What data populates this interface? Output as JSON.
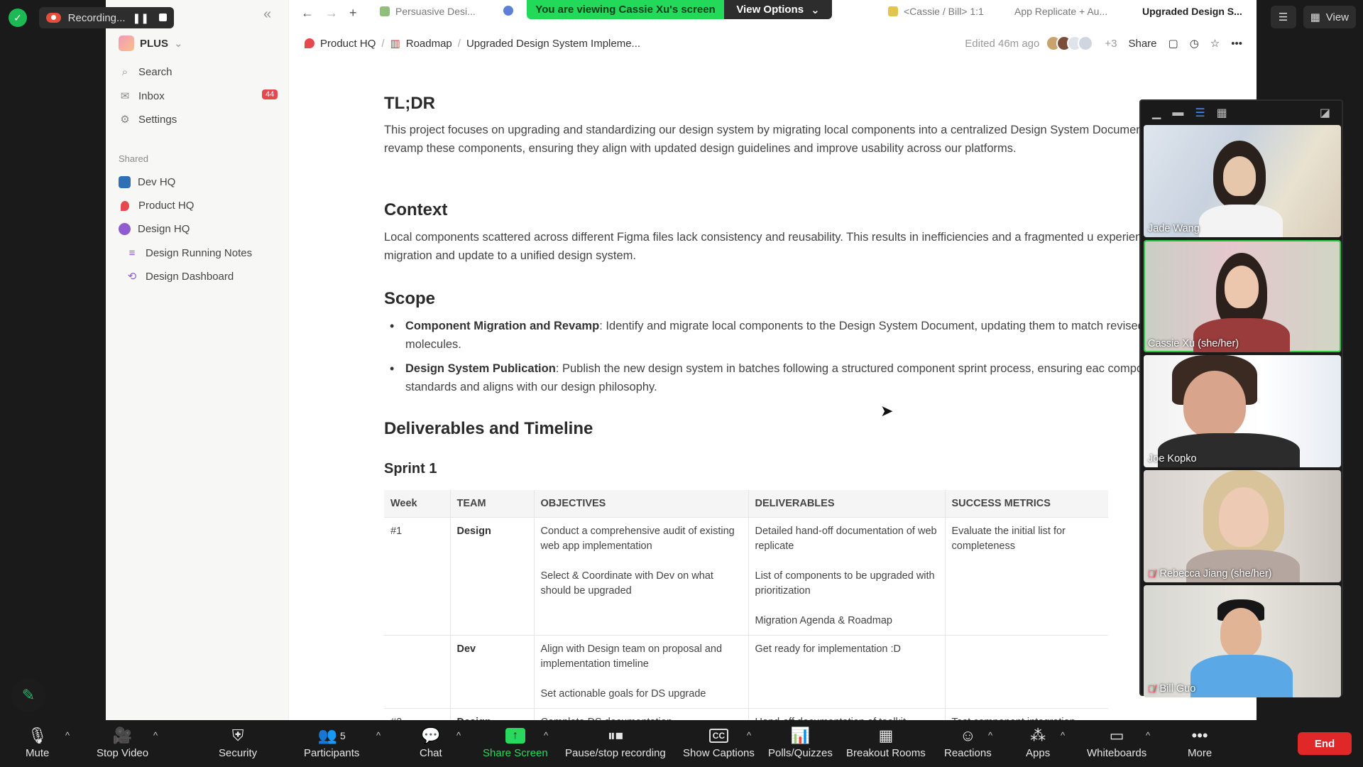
{
  "zoom": {
    "recording_label": "Recording...",
    "view_label": "View",
    "banner": {
      "text": "You are viewing Cassie Xu's screen",
      "options": "View Options"
    },
    "participants_count": "5",
    "toolbar": [
      {
        "label": "Mute"
      },
      {
        "label": "Stop Video"
      },
      {
        "label": "Security"
      },
      {
        "label": "Participants"
      },
      {
        "label": "Chat"
      },
      {
        "label": "Share Screen"
      },
      {
        "label": "Pause/stop recording"
      },
      {
        "label": "Show Captions"
      },
      {
        "label": "Polls/Quizzes"
      },
      {
        "label": "Breakout Rooms"
      },
      {
        "label": "Reactions"
      },
      {
        "label": "Apps"
      },
      {
        "label": "Whiteboards"
      },
      {
        "label": "More"
      }
    ],
    "end_label": "End",
    "captions_badge": "CC",
    "gallery": [
      {
        "name": "Jade Wang",
        "muted": false
      },
      {
        "name": "Cassie Xu (she/her)",
        "muted": false
      },
      {
        "name": "Joe Kopko",
        "muted": false
      },
      {
        "name": "Rebecca Jiang (she/her)",
        "muted": true
      },
      {
        "name": "Bill Guo",
        "muted": true
      }
    ]
  },
  "app": {
    "workspace": "PLUS",
    "nav": [
      {
        "label": "Search",
        "icon": "search-icon"
      },
      {
        "label": "Inbox",
        "icon": "inbox-icon",
        "badge": "44"
      },
      {
        "label": "Settings",
        "icon": "gear-icon"
      }
    ],
    "shared_label": "Shared",
    "shared": [
      {
        "label": "Dev HQ"
      },
      {
        "label": "Product HQ"
      },
      {
        "label": "Design HQ"
      },
      {
        "label": "Design Running Notes"
      },
      {
        "label": "Design Dashboard"
      }
    ],
    "tabs": [
      {
        "label": "Persuasive Desi..."
      },
      {
        "label": "<Cassie / Bill> 1:1"
      },
      {
        "label": "App Replicate + Au..."
      },
      {
        "label": "Upgraded Design S..."
      }
    ],
    "breadcrumb": [
      "Product HQ",
      "Roadmap",
      "Upgraded Design System Impleme..."
    ],
    "edited": "Edited 46m ago",
    "extra_avatars": "+3",
    "share_label": "Share"
  },
  "doc": {
    "tldr_title": "TL;DR",
    "tldr_text": "This project focuses on upgrading and standardizing our design system by migrating local components into a centralized Design System Document. The team will revamp these components, ensuring they align with updated design guidelines and improve usability across our platforms.",
    "context_title": "Context",
    "context_text": "Local components scattered across different Figma files lack consistency and reusability. This results in inefficiencies and a fragmented u experience, necessitating a migration and update to a unified design system.",
    "scope_title": "Scope",
    "scope_1_bold": "Component Migration and Revamp",
    "scope_1_text": ": Identify and migrate local components to the Design System Document, updating them to match revised design atoms and molecules.",
    "scope_2_bold": "Design System Publication",
    "scope_2_text": ": Publish the new design system in batches following a structured component sprint process, ensuring eac component meets quality standards and aligns with our design philosophy.",
    "deliv_title": "Deliverables and Timeline",
    "sprint_title": "Sprint 1",
    "table_headers": [
      "Week",
      "TEAM",
      "OBJECTIVES",
      "DELIVERABLES",
      "SUCCESS METRICS"
    ],
    "rows": [
      {
        "week": "#1",
        "team": "Design",
        "obj_1": "Conduct a comprehensive audit of existing web app implementation",
        "obj_2": "Select & Coordinate with Dev on what should be upgraded",
        "del_1": "Detailed hand-off documentation of web replicate",
        "del_2": "List of components to be upgraded with prioritization",
        "del_3": "Migration Agenda & Roadmap",
        "metric": "Evaluate the initial list for completeness"
      },
      {
        "week": "",
        "team": "Dev",
        "obj_1": "Align with Design team on proposal and implementation timeline",
        "obj_2": "Set actionable goals for DS upgrade",
        "del_1": "Get ready for implementation :D",
        "metric": ""
      },
      {
        "week": "#2",
        "team": "Design",
        "obj_1": "Complete DS documentation",
        "del_1": "Hand-off documentation of toolkit",
        "metric": "Test component integration"
      }
    ]
  }
}
